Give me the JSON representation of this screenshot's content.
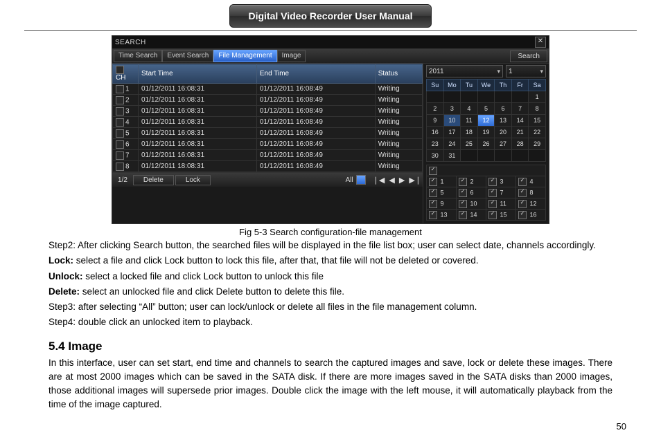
{
  "doc_title": "Digital Video Recorder User Manual",
  "dvr": {
    "window_title": "SEARCH",
    "close_symbol": "✕",
    "tabs": [
      "Time Search",
      "Event Search",
      "File Management",
      "Image"
    ],
    "active_tab_index": 2,
    "search_btn": "Search",
    "columns": {
      "ch": "CH",
      "start": "Start Time",
      "end": "End Time",
      "status": "Status"
    },
    "rows": [
      {
        "ch": "1",
        "start": "01/12/2011 16:08:31",
        "end": "01/12/2011 16:08:49",
        "status": "Writing"
      },
      {
        "ch": "2",
        "start": "01/12/2011 16:08:31",
        "end": "01/12/2011 16:08:49",
        "status": "Writing"
      },
      {
        "ch": "3",
        "start": "01/12/2011 16:08:31",
        "end": "01/12/2011 16:08:49",
        "status": "Writing"
      },
      {
        "ch": "4",
        "start": "01/12/2011 16:08:31",
        "end": "01/12/2011 16:08:49",
        "status": "Writing"
      },
      {
        "ch": "5",
        "start": "01/12/2011 16:08:31",
        "end": "01/12/2011 16:08:49",
        "status": "Writing"
      },
      {
        "ch": "6",
        "start": "01/12/2011 16:08:31",
        "end": "01/12/2011 16:08:49",
        "status": "Writing"
      },
      {
        "ch": "7",
        "start": "01/12/2011 16:08:31",
        "end": "01/12/2011 16:08:49",
        "status": "Writing"
      },
      {
        "ch": "8",
        "start": "01/12/2011 18:08:31",
        "end": "01/12/2011 16:08:49",
        "status": "Writing"
      }
    ],
    "page_indicator": "1/2",
    "delete_btn": "Delete",
    "lock_btn": "Lock",
    "all_label": "All",
    "year": "2011",
    "month": "1",
    "dow": [
      "Su",
      "Mo",
      "Tu",
      "We",
      "Th",
      "Fr",
      "Sa"
    ],
    "cal": [
      [
        "",
        "",
        "",
        "",
        "",
        "",
        "1"
      ],
      [
        "2",
        "3",
        "4",
        "5",
        "6",
        "7",
        "8"
      ],
      [
        "9",
        "10",
        "11",
        "12",
        "13",
        "14",
        "15"
      ],
      [
        "16",
        "17",
        "18",
        "19",
        "20",
        "21",
        "22"
      ],
      [
        "23",
        "24",
        "25",
        "26",
        "27",
        "28",
        "29"
      ],
      [
        "30",
        "31",
        "",
        "",
        "",
        "",
        ""
      ]
    ],
    "highlight_day": "10",
    "selected_day": "12",
    "channels": [
      [
        "1",
        "2",
        "3",
        "4"
      ],
      [
        "5",
        "6",
        "7",
        "8"
      ],
      [
        "9",
        "10",
        "11",
        "12"
      ],
      [
        "13",
        "14",
        "15",
        "16"
      ]
    ]
  },
  "caption": "Fig 5-3 Search configuration-file management",
  "text": {
    "step2": "Step2: After clicking Search button, the searched files will be displayed in the file list box; user can select date, channels accordingly.",
    "lock_b": "Lock:",
    "lock_t": " select a file and click Lock button to lock this file, after that, that file will not be deleted or covered.",
    "unlock_b": "Unlock:",
    "unlock_t": " select a locked file and click Lock button to unlock this file",
    "delete_b": "Delete:",
    "delete_t": " select an unlocked file and click Delete button to delete this file.",
    "step3": "Step3: after selecting “All” button; user can lock/unlock or delete all files in the file management column.",
    "step4": "Step4: double click an unlocked item to playback.",
    "section": "5.4  Image",
    "image_p": "In this interface, user can set start, end time and channels to search the captured images and save, lock or delete these images. There are at most 2000 images which can be saved in the SATA disk. If there are more images saved in the SATA disks than 2000 images, those additional images will supersede prior images. Double click the image with the left mouse, it will automatically playback from the time of the image captured."
  },
  "page_number": "50"
}
